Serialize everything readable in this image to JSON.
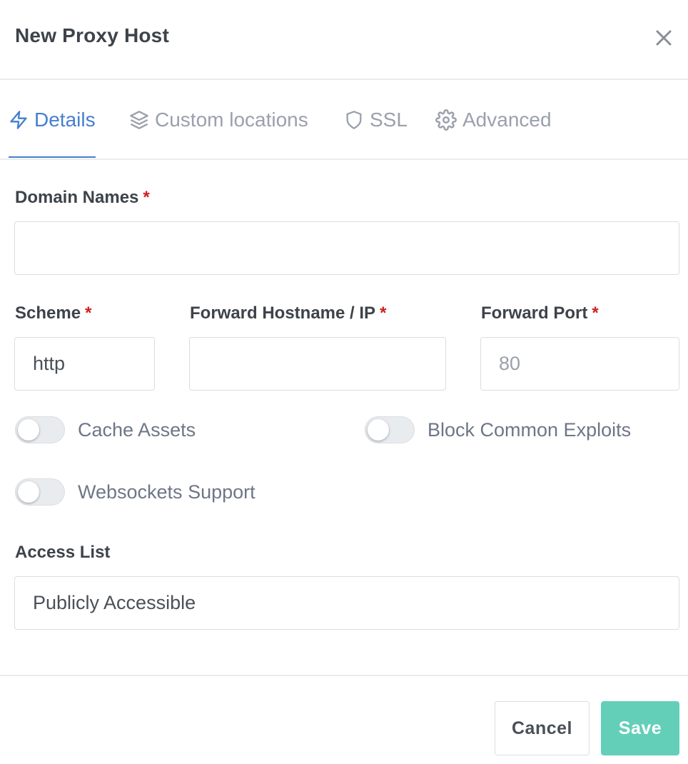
{
  "modal": {
    "title": "New Proxy Host",
    "close_icon": "close-icon"
  },
  "tabs": [
    {
      "label": "Details",
      "icon": "lightning-icon",
      "active": true
    },
    {
      "label": "Custom locations",
      "icon": "layers-icon",
      "active": false
    },
    {
      "label": "SSL",
      "icon": "shield-icon",
      "active": false
    },
    {
      "label": "Advanced",
      "icon": "gear-icon",
      "active": false
    }
  ],
  "form": {
    "domain_names": {
      "label": "Domain Names",
      "required_mark": "*",
      "value": "",
      "placeholder": ""
    },
    "scheme": {
      "label": "Scheme",
      "required_mark": "*",
      "value": "http"
    },
    "forward_host": {
      "label": "Forward Hostname / IP",
      "required_mark": "*",
      "value": "",
      "placeholder": ""
    },
    "forward_port": {
      "label": "Forward Port",
      "required_mark": "*",
      "value": "",
      "placeholder": "80"
    },
    "toggles": {
      "cache_assets": {
        "label": "Cache Assets",
        "checked": false
      },
      "block_exploits": {
        "label": "Block Common Exploits",
        "checked": false
      },
      "websockets": {
        "label": "Websockets Support",
        "checked": false
      }
    },
    "access_list": {
      "label": "Access List",
      "value": "Publicly Accessible"
    }
  },
  "footer": {
    "cancel_label": "Cancel",
    "save_label": "Save"
  },
  "colors": {
    "accent": "#467fcf",
    "required": "#cd201f",
    "save_button": "#63cfb8",
    "border": "#dadde3"
  }
}
